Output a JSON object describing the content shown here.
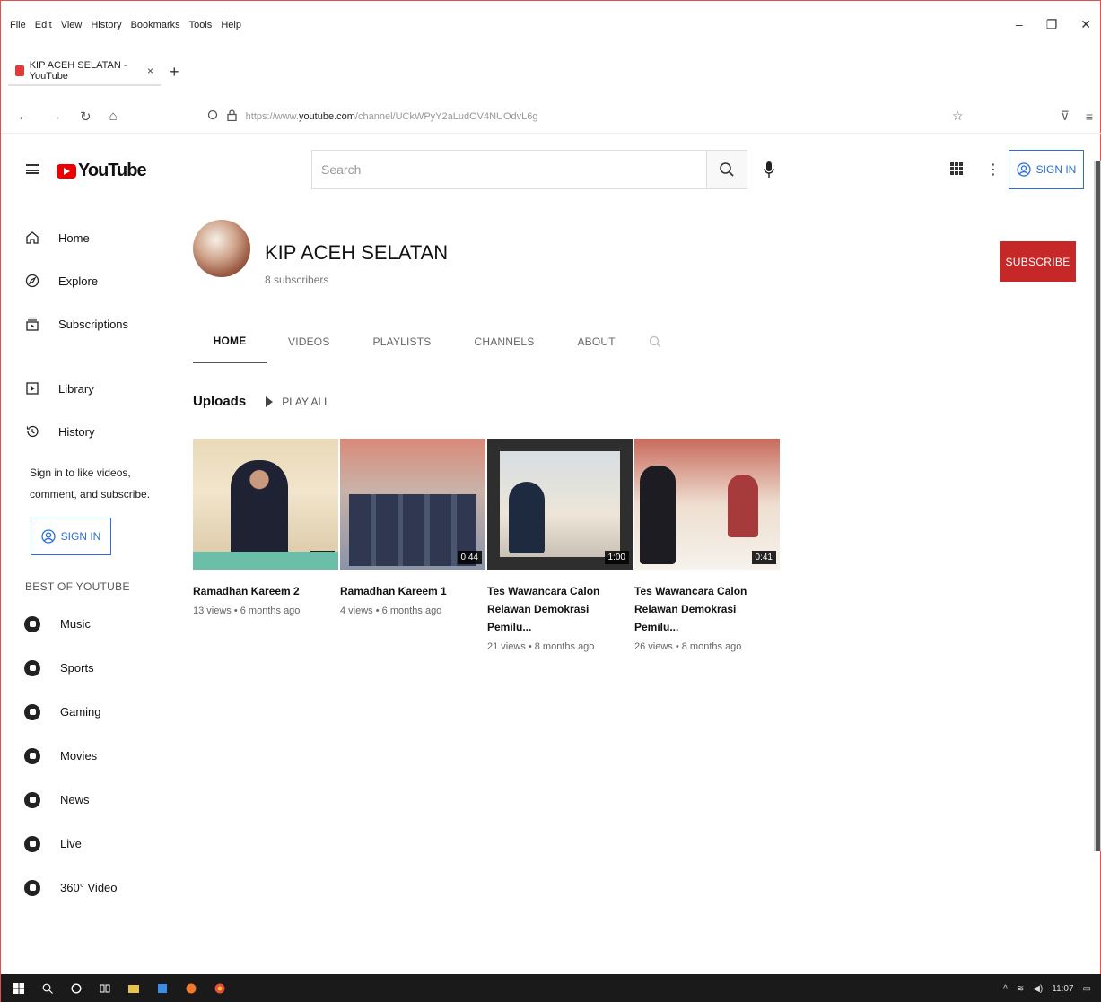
{
  "browser": {
    "menu": [
      "File",
      "Edit",
      "View",
      "History",
      "Bookmarks",
      "Tools",
      "Help"
    ],
    "tab_title": "KIP ACEH SELATAN - YouTube",
    "tab_close": "×",
    "new_tab": "+",
    "url_prefix": "https://www.",
    "url_domain": "youtube.com",
    "url_path": "/channel/UCkWPyY2aLudOV4NUOdvL6g"
  },
  "youtube": {
    "logo_text": "YouTube",
    "search_placeholder": "Search",
    "signin_label": "SIGN IN"
  },
  "sidebar": {
    "items": [
      {
        "label": "Home",
        "icon": "home-icon"
      },
      {
        "label": "Explore",
        "icon": "compass-icon"
      },
      {
        "label": "Subscriptions",
        "icon": "subscriptions-icon"
      }
    ],
    "items2": [
      {
        "label": "Library",
        "icon": "library-icon"
      },
      {
        "label": "History",
        "icon": "history-icon"
      }
    ],
    "signin_prompt": "Sign in to like videos, comment, and subscribe.",
    "signin_label": "SIGN IN",
    "best_heading": "BEST OF YOUTUBE",
    "best": [
      {
        "label": "Music",
        "icon": "music-icon"
      },
      {
        "label": "Sports",
        "icon": "sports-icon"
      },
      {
        "label": "Gaming",
        "icon": "gaming-icon"
      },
      {
        "label": "Movies",
        "icon": "movies-icon"
      },
      {
        "label": "News",
        "icon": "news-icon"
      },
      {
        "label": "Live",
        "icon": "live-icon"
      },
      {
        "label": "360° Video",
        "icon": "360-video-icon"
      }
    ]
  },
  "channel": {
    "name": "KIP ACEH SELATAN",
    "subscribers": "8 subscribers",
    "subscribe_label": "SUBSCRIBE",
    "tabs": [
      "HOME",
      "VIDEOS",
      "PLAYLISTS",
      "CHANNELS",
      "ABOUT"
    ],
    "active_tab": "HOME",
    "uploads_label": "Uploads",
    "play_all_label": "PLAY ALL",
    "videos": [
      {
        "title": "Ramadhan Kareem 2",
        "meta": "13 views • 6 months ago",
        "duration": "0:46"
      },
      {
        "title": "Ramadhan Kareem 1",
        "meta": "4 views • 6 months ago",
        "duration": "0:44"
      },
      {
        "title": "Tes Wawancara Calon Relawan Demokrasi Pemilu...",
        "meta": "21 views • 8 months ago",
        "duration": "1:00"
      },
      {
        "title": "Tes Wawancara Calon Relawan Demokrasi Pemilu...",
        "meta": "26 views • 8 months ago",
        "duration": "0:41"
      }
    ]
  },
  "taskbar": {
    "time": "11:07"
  },
  "colors": {
    "youtube_red": "#e00000",
    "subscribe_red": "#c62828",
    "signin_blue": "#2a6ed6"
  }
}
